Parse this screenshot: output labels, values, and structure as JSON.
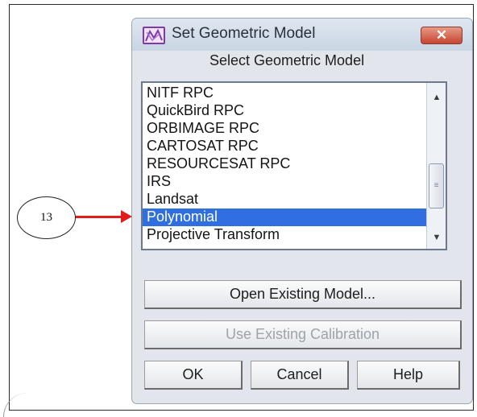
{
  "dialog": {
    "title": "Set Geometric Model",
    "close_label": "✕",
    "subtitle": "Select Geometric Model",
    "list_items": [
      {
        "label": "NITF RPC",
        "selected": false
      },
      {
        "label": "QuickBird RPC",
        "selected": false
      },
      {
        "label": "ORBIMAGE RPC",
        "selected": false
      },
      {
        "label": "CARTOSAT RPC",
        "selected": false
      },
      {
        "label": "RESOURCESAT RPC",
        "selected": false
      },
      {
        "label": "IRS",
        "selected": false
      },
      {
        "label": "Landsat",
        "selected": false
      },
      {
        "label": "Polynomial",
        "selected": true
      },
      {
        "label": "Projective Transform",
        "selected": false
      }
    ],
    "buttons": {
      "open_existing": "Open Existing Model...",
      "use_existing_calibration": "Use Existing Calibration",
      "ok": "OK",
      "cancel": "Cancel",
      "help": "Help"
    }
  },
  "annotation": {
    "callout_number": "13",
    "arrow_color": "#e21b1b"
  },
  "colors": {
    "selection": "#2f6fe0",
    "dialog_bg": "#e2e6ec",
    "close_button": "#c7452f",
    "disabled_text": "#9ea4ab"
  },
  "icons": {
    "app": "geometric-model-app-icon",
    "close": "close-icon",
    "scroll_up": "scroll-up-arrow-icon",
    "scroll_down": "scroll-down-arrow-icon"
  }
}
